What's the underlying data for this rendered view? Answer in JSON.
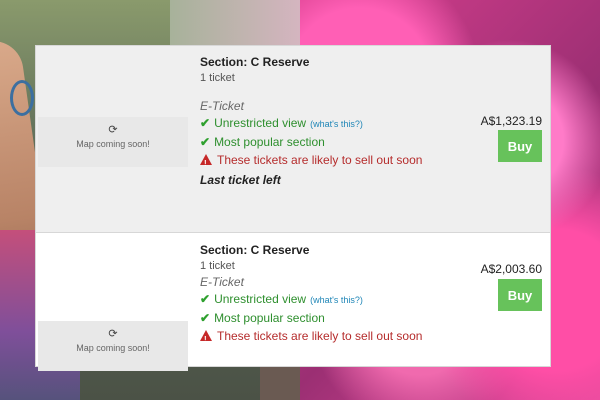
{
  "listings": [
    {
      "section": "Section: C Reserve",
      "ticket_count": "1 ticket",
      "map_text": "Map coming soon!",
      "ticket_type": "E-Ticket",
      "features": [
        {
          "label": "Unrestricted view",
          "link": "(what's this?)"
        },
        {
          "label": "Most popular section",
          "link": ""
        }
      ],
      "warning": "These tickets are likely to sell out soon",
      "last_ticket": "Last ticket left",
      "price": "A$1,323.19",
      "buy_label": "Buy"
    },
    {
      "section": "Section: C Reserve",
      "ticket_count": "1 ticket",
      "map_text": "Map coming soon!",
      "ticket_type": "E-Ticket",
      "features": [
        {
          "label": "Unrestricted view",
          "link": "(what's this?)"
        },
        {
          "label": "Most popular section",
          "link": ""
        }
      ],
      "warning": "These tickets are likely to sell out soon",
      "price": "A$2,003.60",
      "buy_label": "Buy"
    }
  ],
  "colors": {
    "buy": "#67c25b",
    "feature": "#2e8f2e",
    "warning": "#b52c2c",
    "link": "#1f86b7"
  },
  "icons": {
    "refresh": "refresh-icon",
    "check": "check-icon",
    "warning": "warning-icon"
  }
}
